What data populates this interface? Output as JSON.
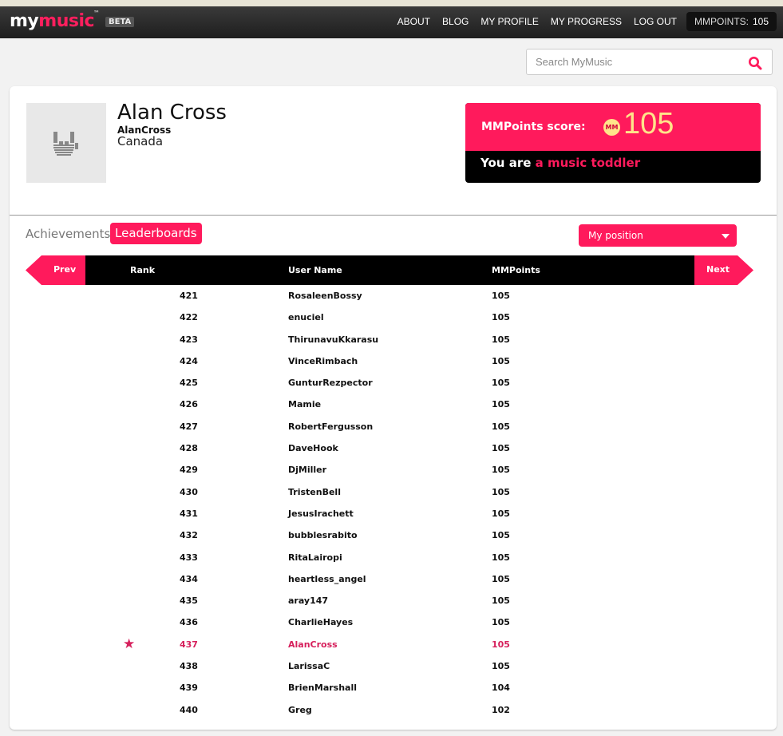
{
  "logo": {
    "my": "my",
    "music": "music",
    "tm": "™",
    "beta": "BETA"
  },
  "nav": [
    "ABOUT",
    "BLOG",
    "MY PROFILE",
    "MY PROGRESS",
    "LOG OUT"
  ],
  "points_badge": {
    "label": "MMPOINTS:",
    "value": "105"
  },
  "search": {
    "placeholder": "Search MyMusic"
  },
  "profile": {
    "name": "Alan Cross",
    "username": "AlanCross",
    "country": "Canada"
  },
  "score": {
    "label": "MMPoints score:",
    "coin": "MM",
    "value": "105",
    "level_prefix": "You are",
    "level": "a music toddler"
  },
  "tabs": {
    "achievements": "Achievements",
    "leaderboards": "Leaderboards"
  },
  "position_select": {
    "selected": "My position"
  },
  "leaderboard": {
    "prev": "Prev",
    "next": "Next",
    "headers": {
      "rank": "Rank",
      "user": "User Name",
      "points": "MMPoints"
    },
    "rows": [
      {
        "rank": "421",
        "user": "RosaleenBossy",
        "points": "105",
        "me": false
      },
      {
        "rank": "422",
        "user": "enuciel",
        "points": "105",
        "me": false
      },
      {
        "rank": "423",
        "user": "ThirunavuKkarasu",
        "points": "105",
        "me": false
      },
      {
        "rank": "424",
        "user": "VinceRimbach",
        "points": "105",
        "me": false
      },
      {
        "rank": "425",
        "user": "GunturRezpector",
        "points": "105",
        "me": false
      },
      {
        "rank": "426",
        "user": "Mamie",
        "points": "105",
        "me": false
      },
      {
        "rank": "427",
        "user": "RobertFergusson",
        "points": "105",
        "me": false
      },
      {
        "rank": "428",
        "user": "DaveHook",
        "points": "105",
        "me": false
      },
      {
        "rank": "429",
        "user": "DjMiller",
        "points": "105",
        "me": false
      },
      {
        "rank": "430",
        "user": "TristenBell",
        "points": "105",
        "me": false
      },
      {
        "rank": "431",
        "user": "JesusIrachett",
        "points": "105",
        "me": false
      },
      {
        "rank": "432",
        "user": "bubblesrabito",
        "points": "105",
        "me": false
      },
      {
        "rank": "433",
        "user": "RitaLairopi",
        "points": "105",
        "me": false
      },
      {
        "rank": "434",
        "user": "heartless_angel",
        "points": "105",
        "me": false
      },
      {
        "rank": "435",
        "user": "aray147",
        "points": "105",
        "me": false
      },
      {
        "rank": "436",
        "user": "CharlieHayes",
        "points": "105",
        "me": false
      },
      {
        "rank": "437",
        "user": "AlanCross",
        "points": "105",
        "me": true
      },
      {
        "rank": "438",
        "user": "LarissaC",
        "points": "105",
        "me": false
      },
      {
        "rank": "439",
        "user": "BrienMarshall",
        "points": "104",
        "me": false
      },
      {
        "rank": "440",
        "user": "Greg",
        "points": "102",
        "me": false
      }
    ]
  },
  "colors": {
    "accent": "#ff1a5c",
    "highlight_text": "#d6205c",
    "coin": "#ffe48a"
  },
  "icons": {
    "search": "search-icon",
    "avatar": "rock-hand-icon",
    "star": "star-icon"
  }
}
